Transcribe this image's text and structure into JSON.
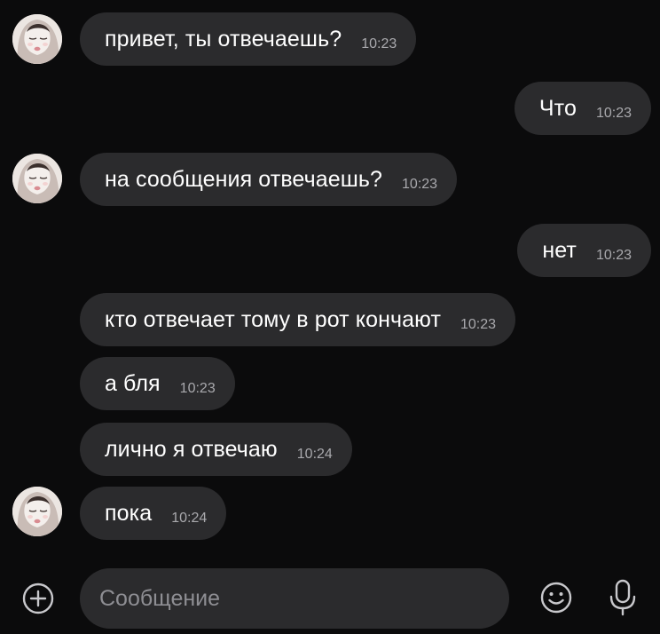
{
  "messages": [
    {
      "text": "привет, ты отвечаешь?",
      "time": "10:23",
      "side": "incoming"
    },
    {
      "text": "Что",
      "time": "10:23",
      "side": "outgoing"
    },
    {
      "text": "на сообщения отвечаешь?",
      "time": "10:23",
      "side": "incoming"
    },
    {
      "text": "нет",
      "time": "10:23",
      "side": "outgoing"
    },
    {
      "text": "кто отвечает тому в рот кончают",
      "time": "10:23",
      "side": "incoming"
    },
    {
      "text": "а бля",
      "time": "10:23",
      "side": "incoming"
    },
    {
      "text": "лично я отвечаю",
      "time": "10:24",
      "side": "incoming"
    },
    {
      "text": "пока",
      "time": "10:24",
      "side": "incoming"
    }
  ],
  "composer": {
    "placeholder": "Сообщение"
  },
  "icons": {
    "attach": "plus-circle-icon",
    "emoji": "smiley-icon",
    "voice": "microphone-icon"
  },
  "colors": {
    "background": "#0b0b0c",
    "bubble": "#2b2b2d",
    "text": "#ffffff",
    "time": "#a9a9ad"
  }
}
